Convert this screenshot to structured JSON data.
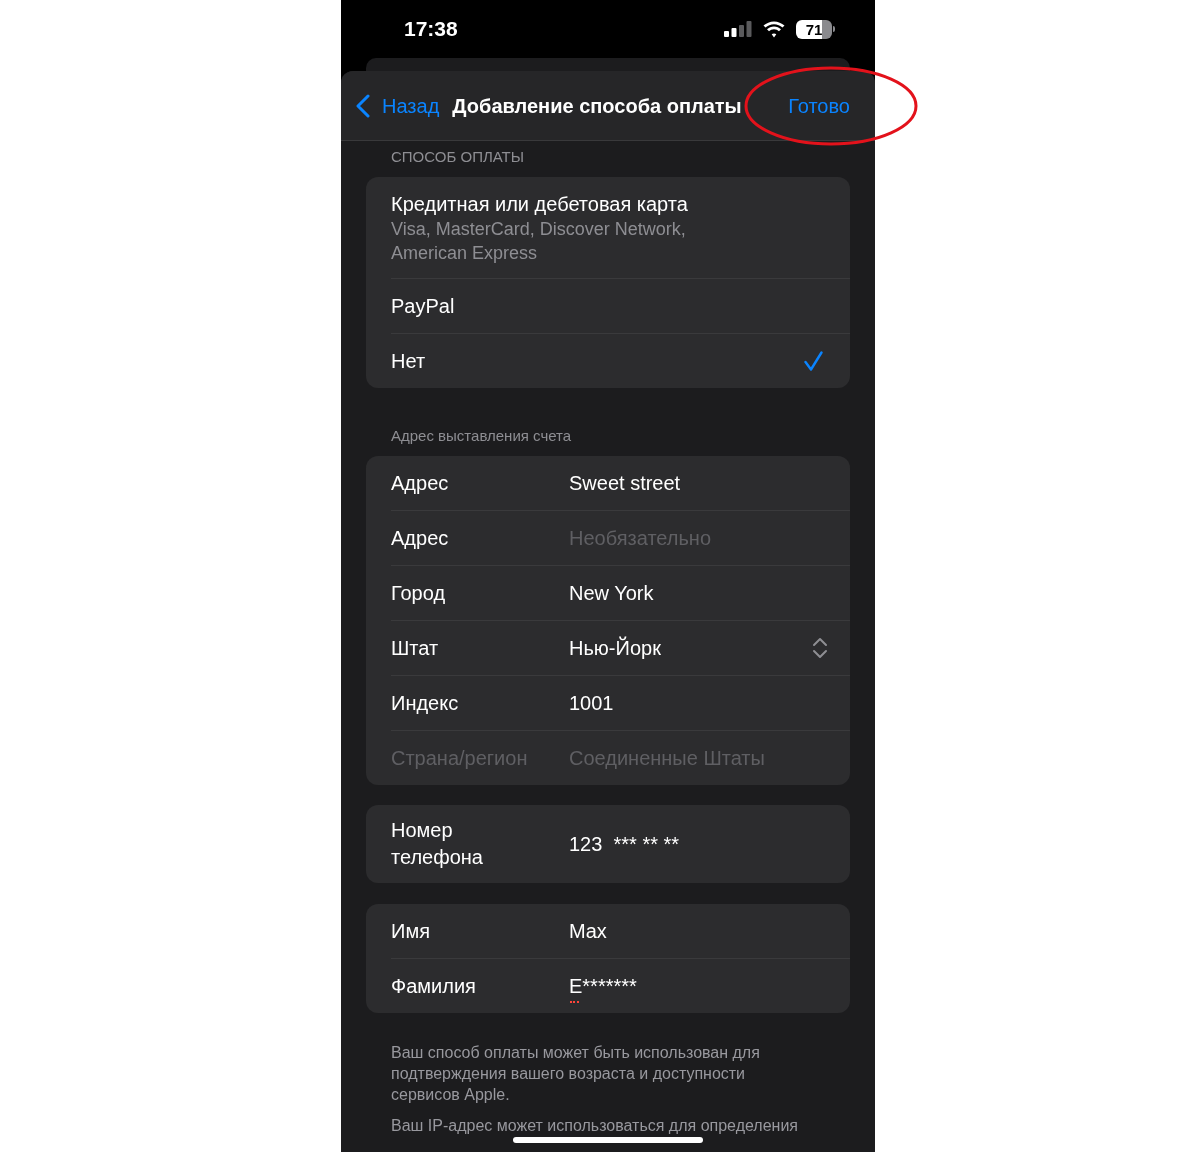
{
  "status_bar": {
    "time": "17:38",
    "battery": "71"
  },
  "nav": {
    "back": "Назад",
    "title": "Добавление способа оплаты",
    "done": "Готово"
  },
  "payment_method": {
    "header": "СПОСОБ ОПЛАТЫ",
    "options": [
      {
        "label": "Кредитная или дебетовая карта",
        "detail": "Visa, MasterCard, Discover Network, American Express",
        "selected": false
      },
      {
        "label": "PayPal",
        "selected": false
      },
      {
        "label": "Нет",
        "selected": true
      }
    ]
  },
  "billing_address": {
    "header": "Адрес выставления счета",
    "rows": [
      {
        "kind": "text",
        "label": "Адрес",
        "value": "Sweet street",
        "disabled": false
      },
      {
        "kind": "text",
        "label": "Адрес",
        "placeholder": "Необязательно",
        "disabled": false
      },
      {
        "kind": "text",
        "label": "Город",
        "value": "New York",
        "disabled": false
      },
      {
        "kind": "picker",
        "label": "Штат",
        "value": "Нью-Йорк",
        "disabled": false
      },
      {
        "kind": "text",
        "label": "Индекс",
        "value": "1001",
        "disabled": false
      },
      {
        "kind": "text",
        "label": "Страна/регион",
        "value": "Соединенные Штаты",
        "disabled": true
      }
    ]
  },
  "phone": {
    "rows": [
      {
        "label": "Номер телефона",
        "value": "123  *** ** **"
      }
    ]
  },
  "name_fields": {
    "rows": [
      {
        "label": "Имя",
        "value": "Max",
        "misspelled": false
      },
      {
        "label": "Фамилия",
        "value": "E*******",
        "misspelled": true
      }
    ]
  },
  "notes": [
    "Ваш способ оплаты может быть использован для подтверждения вашего возраста и доступности сервисов Apple.",
    "Ваш IP-адрес может использоваться для определения"
  ]
}
